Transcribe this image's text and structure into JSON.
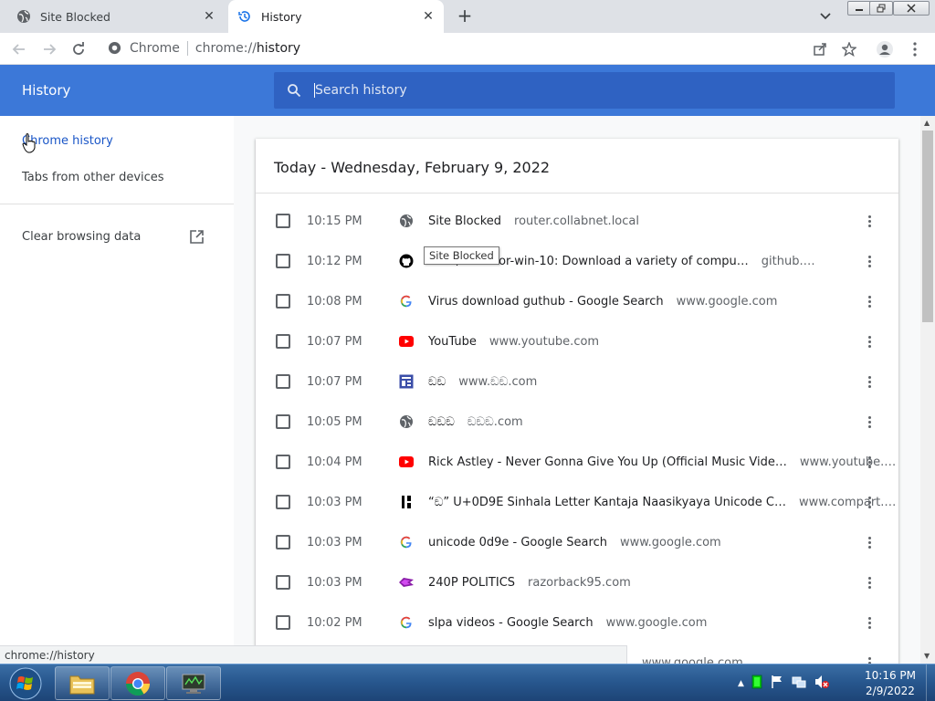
{
  "tabs": [
    {
      "title": "Site Blocked",
      "icon": "globe-icon"
    },
    {
      "title": "History",
      "icon": "history-icon"
    }
  ],
  "toolbar": {
    "scheme_label": "Chrome",
    "url_prefix": "chrome://",
    "url_path": "history"
  },
  "header": {
    "title": "History",
    "search_placeholder": "Search history"
  },
  "sidebar": {
    "items": [
      {
        "label": "Chrome history"
      },
      {
        "label": "Tabs from other devices"
      },
      {
        "label": "Clear browsing data"
      }
    ]
  },
  "main": {
    "date_heading": "Today - Wednesday, February 9, 2022",
    "rows": [
      {
        "time": "10:15 PM",
        "favicon": "globe-icon",
        "title": "Site Blocked",
        "domain": "router.collabnet.local"
      },
      {
        "time": "10:12 PM",
        "favicon": "github-icon",
        "title": "W1N/Virus-for-win-10: Download a variety of compu…",
        "domain": "github.…"
      },
      {
        "time": "10:08 PM",
        "favicon": "google-icon",
        "title": "Virus download guthub - Google Search",
        "domain": "www.google.com"
      },
      {
        "time": "10:07 PM",
        "favicon": "youtube-icon",
        "title": "YouTube",
        "domain": "www.youtube.com"
      },
      {
        "time": "10:07 PM",
        "favicon": "site-layout-icon",
        "title": "ඞඞ",
        "domain": "www.ඞඞ.com"
      },
      {
        "time": "10:05 PM",
        "favicon": "globe-icon",
        "title": "ඞඞඞ",
        "domain": "ඞඞඞ.com"
      },
      {
        "time": "10:04 PM",
        "favicon": "youtube-icon",
        "title": "Rick Astley - Never Gonna Give You Up (Official Music Vide…",
        "domain": "www.youtube.…"
      },
      {
        "time": "10:03 PM",
        "favicon": "compart-icon",
        "title": "“ඞ” U+0D9E Sinhala Letter Kantaja Naasikyaya Unicode C…",
        "domain": "www.compart.…"
      },
      {
        "time": "10:03 PM",
        "favicon": "google-icon",
        "title": "unicode 0d9e - Google Search",
        "domain": "www.google.com"
      },
      {
        "time": "10:03 PM",
        "favicon": "razorback-icon",
        "title": "240P POLITICS",
        "domain": "razorback95.com"
      },
      {
        "time": "10:02 PM",
        "favicon": "google-icon",
        "title": "slpa videos - Google Search",
        "domain": "www.google.com"
      },
      {
        "time": "",
        "favicon": "",
        "title": "",
        "domain": "www.google.com"
      }
    ],
    "tooltip": "Site Blocked"
  },
  "status_bubble": "chrome://history",
  "taskbar": {
    "apps": [
      "file-explorer-icon",
      "chrome-icon",
      "network-tool-icon"
    ],
    "clock_time": "10:16 PM",
    "clock_date": "2/9/2022"
  },
  "colors": {
    "header_blue": "#3c78d8",
    "search_blue": "#2f62c2",
    "active_link": "#1a56c7"
  }
}
